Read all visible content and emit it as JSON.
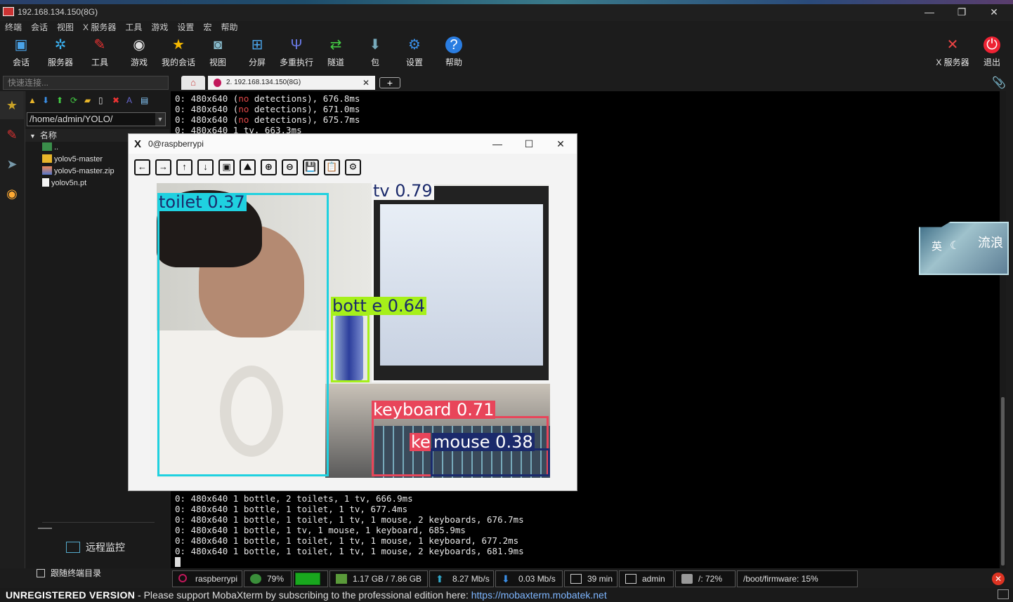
{
  "window": {
    "title": "192.168.134.150(8G)",
    "controls": {
      "minimize": "—",
      "restore": "❐",
      "close": "✕"
    }
  },
  "menu": [
    "终端",
    "会话",
    "视图",
    "X 服务器",
    "工具",
    "游戏",
    "设置",
    "宏",
    "帮助"
  ],
  "toolbar": [
    {
      "label": "会话",
      "icon": "session-icon"
    },
    {
      "label": "服务器",
      "icon": "servers-icon"
    },
    {
      "label": "工具",
      "icon": "tools-icon"
    },
    {
      "label": "游戏",
      "icon": "games-icon"
    },
    {
      "label": "我的会话",
      "icon": "star-icon"
    },
    {
      "label": "视图",
      "icon": "view-icon"
    },
    {
      "label": "分屏",
      "icon": "split-icon"
    },
    {
      "label": "多重执行",
      "icon": "multiexec-icon"
    },
    {
      "label": "隧道",
      "icon": "tunnel-icon"
    },
    {
      "label": "包",
      "icon": "packages-icon"
    },
    {
      "label": "设置",
      "icon": "settings-icon"
    },
    {
      "label": "帮助",
      "icon": "help-icon"
    }
  ],
  "toolbar_right": [
    {
      "label": "X 服务器",
      "icon": "xserver-icon"
    },
    {
      "label": "退出",
      "icon": "power-icon"
    }
  ],
  "quick_connect": {
    "placeholder": "快速连接..."
  },
  "tabs": {
    "session_label": "2. 192.168.134.150(8G)",
    "close": "✕",
    "add": "+"
  },
  "sidebar": {
    "path": "/home/admin/YOLO/",
    "column_header": "名称",
    "files": [
      {
        "name": "..",
        "type": "parent"
      },
      {
        "name": "yolov5-master",
        "type": "folder"
      },
      {
        "name": "yolov5-master.zip",
        "type": "zip"
      },
      {
        "name": "yolov5n.pt",
        "type": "file"
      }
    ],
    "remote_monitor": "远程监控",
    "follow_terminal": "跟随终端目录"
  },
  "terminal": {
    "top_lines": [
      [
        "0: 480x640 (",
        "no",
        " detections), 676.8ms"
      ],
      [
        "0: 480x640 (",
        "no",
        " detections), 671.0ms"
      ],
      [
        "0: 480x640 (",
        "no",
        " detections), 675.7ms"
      ],
      [
        "0: 480x640 1 tv, 663.3ms",
        "",
        ""
      ]
    ],
    "bottom_lines": [
      "0: 480x640 1 bottle, 2 toilets, 1 tv, 666.9ms",
      "0: 480x640 1 bottle, 1 toilet, 1 tv, 677.4ms",
      "0: 480x640 1 bottle, 1 toilet, 1 tv, 1 mouse, 2 keyboards, 676.7ms",
      "0: 480x640 1 bottle, 1 tv, 1 mouse, 1 keyboard, 685.9ms",
      "0: 480x640 1 bottle, 1 toilet, 1 tv, 1 mouse, 1 keyboard, 677.2ms",
      "0: 480x640 1 bottle, 1 toilet, 1 tv, 1 mouse, 2 keyboards, 681.9ms"
    ]
  },
  "xwindow": {
    "title": "0@raspberrypi",
    "controls": {
      "minimize": "—",
      "maximize": "☐",
      "close": "✕"
    },
    "tools": [
      "←",
      "→",
      "↑",
      "↓",
      "▣",
      "⛰",
      "⊕",
      "⊖",
      "💾",
      "📋",
      "⚙"
    ],
    "tool_names": [
      "back-icon",
      "forward-icon",
      "up-icon",
      "down-icon",
      "fit-icon",
      "image-icon",
      "zoom-in-icon",
      "zoom-out-icon",
      "save-icon",
      "clipboard-icon",
      "settings-icon"
    ],
    "detections": [
      {
        "label": "toilet 0.37",
        "color": "#1fd1e0",
        "text_color": "#1b2a6b"
      },
      {
        "label": "tv 0.79",
        "color": "#f5f5f5",
        "text_color": "#1b2a6b"
      },
      {
        "label": "bott e 0.64",
        "color": "#a6f01a",
        "text_color": "#1b2a6b"
      },
      {
        "label": "keyboard 0.71",
        "color": "#e8455a",
        "text_color": "#ffffff"
      },
      {
        "label": "mouse 0.38",
        "color": "#1b2a6b",
        "text_color": "#ffffff"
      },
      {
        "label": "ke",
        "color": "#e8455a",
        "text_color": "#ffffff"
      }
    ]
  },
  "status": {
    "host": "raspberrypi",
    "cpu": "79%",
    "cpu_level": 0.79,
    "memory": "1.17 GB / 7.86 GB",
    "upload": "8.27 Mb/s",
    "download": "0.03 Mb/s",
    "uptime": "39 min",
    "user": "admin",
    "disk_root": "/: 72%",
    "disk_boot": "/boot/firmware: 15%"
  },
  "bottombar": {
    "edition": "UNREGISTERED VERSION",
    "message": "  -  Please support MobaXterm by subscribing to the professional edition here:  ",
    "link": "https://mobaxterm.mobatek.net"
  },
  "widget": {
    "char_left": "英",
    "moon": "☾",
    "glyph": "流浪"
  },
  "colors": {
    "accent": "#3a7bd5",
    "terminal_bg": "#000000",
    "error_red": "#e24848"
  }
}
